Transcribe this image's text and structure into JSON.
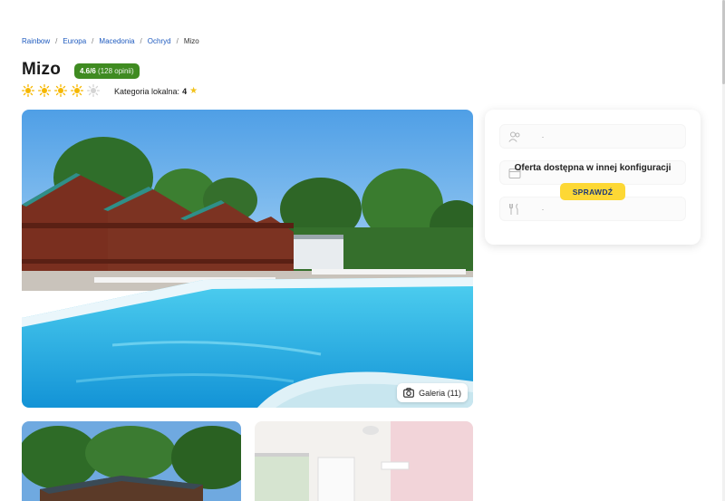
{
  "breadcrumb": {
    "items": [
      "Rainbow",
      "Europa",
      "Macedonia",
      "Ochryd"
    ],
    "current": "Mizo",
    "separator": "/"
  },
  "hotel": {
    "name": "Mizo",
    "rating_score": "4.6/6",
    "rating_count": "(128 opinii)",
    "suns_filled": 4,
    "suns_total": 5,
    "local_category_label": "Kategoria lokalna:",
    "local_category_value": "4"
  },
  "gallery": {
    "button_label": "Galeria (11)",
    "icon": "camera-icon"
  },
  "offer": {
    "message": "Oferta dostępna w innej konfiguracji",
    "button_label": "SPRAWDŹ",
    "field_icons": [
      "people-icon",
      "calendar-icon",
      "cutlery-icon"
    ]
  },
  "colors": {
    "accent_yellow": "#fdd835",
    "rating_green": "#3f8b21",
    "link_blue": "#1f5bbf",
    "button_text": "#1e3a78",
    "sun": "#f6b700"
  }
}
